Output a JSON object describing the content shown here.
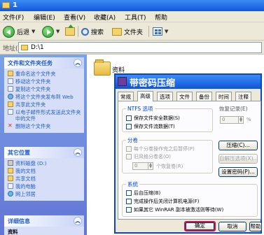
{
  "window": {
    "title": "1"
  },
  "menu": [
    {
      "label": "文件(F)"
    },
    {
      "label": "编辑(E)"
    },
    {
      "label": "查看(V)"
    },
    {
      "label": "收藏(A)"
    },
    {
      "label": "工具(T)"
    },
    {
      "label": "帮助"
    }
  ],
  "toolbar": {
    "back_label": "后退",
    "search_label": "搜索",
    "folders_label": "文件夹"
  },
  "address": {
    "label": "地址(D)",
    "value": "D:\\1"
  },
  "left_pane": {
    "file_tasks": {
      "title": "文件和文件夹任务",
      "items": [
        {
          "label": "重命名这个文件夹",
          "icon": "rename-icon"
        },
        {
          "label": "移动这个文件夹",
          "icon": "move-icon"
        },
        {
          "label": "复制这个文件夹",
          "icon": "copy-icon"
        },
        {
          "label": "将这个文件夹发布到 Web",
          "icon": "publish-icon"
        },
        {
          "label": "共享此文件夹",
          "icon": "share-icon"
        },
        {
          "label": "以电子邮件形式发送此文件夹中的文件",
          "icon": "email-icon"
        },
        {
          "label": "删除这个文件夹",
          "icon": "delete-icon"
        }
      ]
    },
    "other_places": {
      "title": "其它位置",
      "items": [
        {
          "label": "资料磁盘 (D:)",
          "icon": "drive-icon"
        },
        {
          "label": "我的文档",
          "icon": "my-documents-icon"
        },
        {
          "label": "共享文档",
          "icon": "shared-documents-icon"
        },
        {
          "label": "我的电脑",
          "icon": "my-computer-icon"
        },
        {
          "label": "网上邻居",
          "icon": "network-icon"
        }
      ]
    },
    "details": {
      "title": "详细信息",
      "item": "资料"
    }
  },
  "content": {
    "folders": [
      {
        "label": "资料"
      }
    ]
  },
  "dialog": {
    "title": "带密码压缩",
    "tabs": [
      {
        "label": "常规",
        "active": false
      },
      {
        "label": "高级",
        "active": true
      },
      {
        "label": "选项",
        "active": false
      },
      {
        "label": "文件",
        "active": false
      },
      {
        "label": "备份",
        "active": false
      },
      {
        "label": "时间",
        "active": false
      },
      {
        "label": "注释",
        "active": false
      }
    ],
    "ntfs": {
      "label": "NTFS 选项",
      "options": [
        {
          "label": "保存文件安全数据(S)",
          "checked": false
        },
        {
          "label": "保存文件流数据(T)",
          "checked": false
        }
      ]
    },
    "recovery": {
      "label": "恢复记录(E)",
      "value": "0",
      "unit": "%"
    },
    "volumes": {
      "label": "分卷",
      "options": [
        {
          "label": "每个分卷操作完之后暂停(P)",
          "checked": false
        },
        {
          "label": "旧风格分卷名(O)",
          "checked": false
        }
      ],
      "spin_value": "0",
      "spin_label": "个恢复卷(R)"
    },
    "side_buttons": {
      "compression": "压缩(C)...",
      "self_extract": "自解压选项(X)...",
      "set_password": "设置密码(P)..."
    },
    "system": {
      "label": "系统",
      "options": [
        {
          "label": "后台压缩(B)",
          "checked": false
        },
        {
          "label": "完成操作后关闭计算机电源(F)",
          "checked": false
        },
        {
          "label": "如果其它 WinRAR 副本被激活则等待(W)",
          "checked": false
        }
      ]
    },
    "ok_label": "确定",
    "cancel_label": "取消",
    "help_label": "帮助"
  },
  "colors": {
    "titlebar": "#1358d9",
    "task_link": "#215dc6",
    "group_label": "#0046d5",
    "ok_highlight": "#d0144a"
  }
}
